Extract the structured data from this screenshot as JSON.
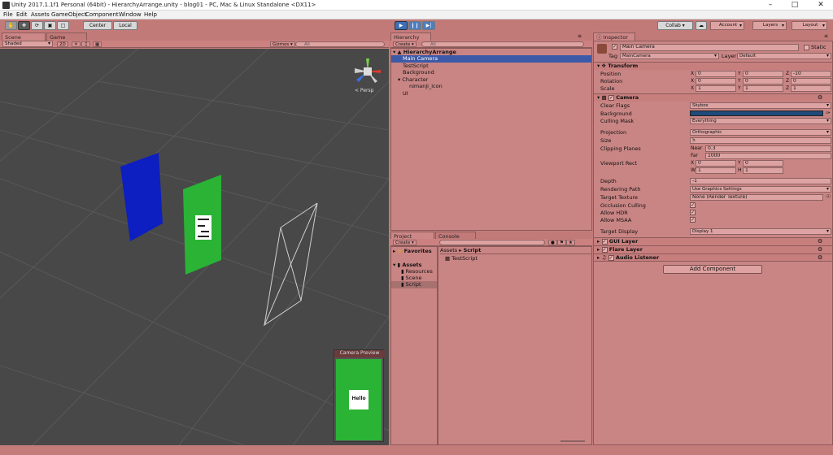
{
  "window": {
    "title": "Unity 2017.1.1f1 Personal (64bit) - HierarchyArrange.unity - blog01 - PC, Mac & Linux Standalone <DX11>",
    "min": "–",
    "max": "□",
    "close": "✕"
  },
  "menu": [
    "File",
    "Edit",
    "Assets",
    "GameObject",
    "Component",
    "Window",
    "Help"
  ],
  "toolbar": {
    "center": "Center",
    "local": "Local",
    "collab": "Collab ▾",
    "account": "Account",
    "layers": "Layers",
    "layout": "Layout",
    "cloud": "☁"
  },
  "scene": {
    "tab_scene": "Scene",
    "tab_game": "Game",
    "shaded": "Shaded",
    "mode2d": "2D",
    "gizmos": "Gizmos ▾",
    "search": "All",
    "persp": "< Persp",
    "preview_title": "Camera Preview",
    "logo_text": "Hello"
  },
  "hierarchy": {
    "tab": "Hierarchy",
    "create": "Create ▾",
    "search": "All",
    "scene": "HierarchyArrange",
    "items": [
      "Main Camera",
      "TestScript",
      "Background",
      "Character",
      "nimanji_icon",
      "UI"
    ]
  },
  "project": {
    "tab_project": "Project",
    "tab_console": "Console",
    "create": "Create ▾",
    "favorites": "Favorites",
    "assets": "Assets",
    "folders": [
      "Resources",
      "Scene",
      "Script"
    ],
    "path_assets": "Assets",
    "path_sep": "▸",
    "path_script": "Script",
    "file": "TestScript",
    "search": ""
  },
  "inspector": {
    "tab": "Inspector",
    "name": "Main Camera",
    "static": "Static",
    "tag_label": "Tag",
    "tag": "MainCamera",
    "layer_label": "Layer",
    "layer": "Default",
    "transform": {
      "title": "Transform",
      "position": "Position",
      "rotation": "Rotation",
      "scale": "Scale",
      "pos": [
        "0",
        "0",
        "-10"
      ],
      "rot": [
        "0",
        "0",
        "0"
      ],
      "scl": [
        "1",
        "1",
        "1"
      ],
      "x": "X",
      "y": "Y",
      "z": "Z"
    },
    "camera": {
      "title": "Camera",
      "clear_flags": "Clear Flags",
      "clear_flags_val": "Skybox",
      "background": "Background",
      "culling_mask": "Culling Mask",
      "culling_mask_val": "Everything",
      "projection": "Projection",
      "projection_val": "Orthographic",
      "size": "Size",
      "size_val": "5",
      "clipping": "Clipping Planes",
      "near": "Near",
      "near_val": "0.3",
      "far": "Far",
      "far_val": "1000",
      "viewport": "Viewport Rect",
      "vx": "0",
      "vy": "0",
      "vw": "1",
      "vh": "1",
      "w": "W",
      "h": "H",
      "depth": "Depth",
      "depth_val": "-1",
      "rendering_path": "Rendering Path",
      "rendering_path_val": "Use Graphics Settings",
      "target_texture": "Target Texture",
      "target_texture_val": "None (Render Texture)",
      "occlusion": "Occlusion Culling",
      "hdr": "Allow HDR",
      "msaa": "Allow MSAA",
      "target_display": "Target Display",
      "target_display_val": "Display 1"
    },
    "components": [
      "GUI Layer",
      "Flare Layer",
      "Audio Listener"
    ],
    "add_component": "Add Component",
    "background_color": "#1f4a7a"
  }
}
